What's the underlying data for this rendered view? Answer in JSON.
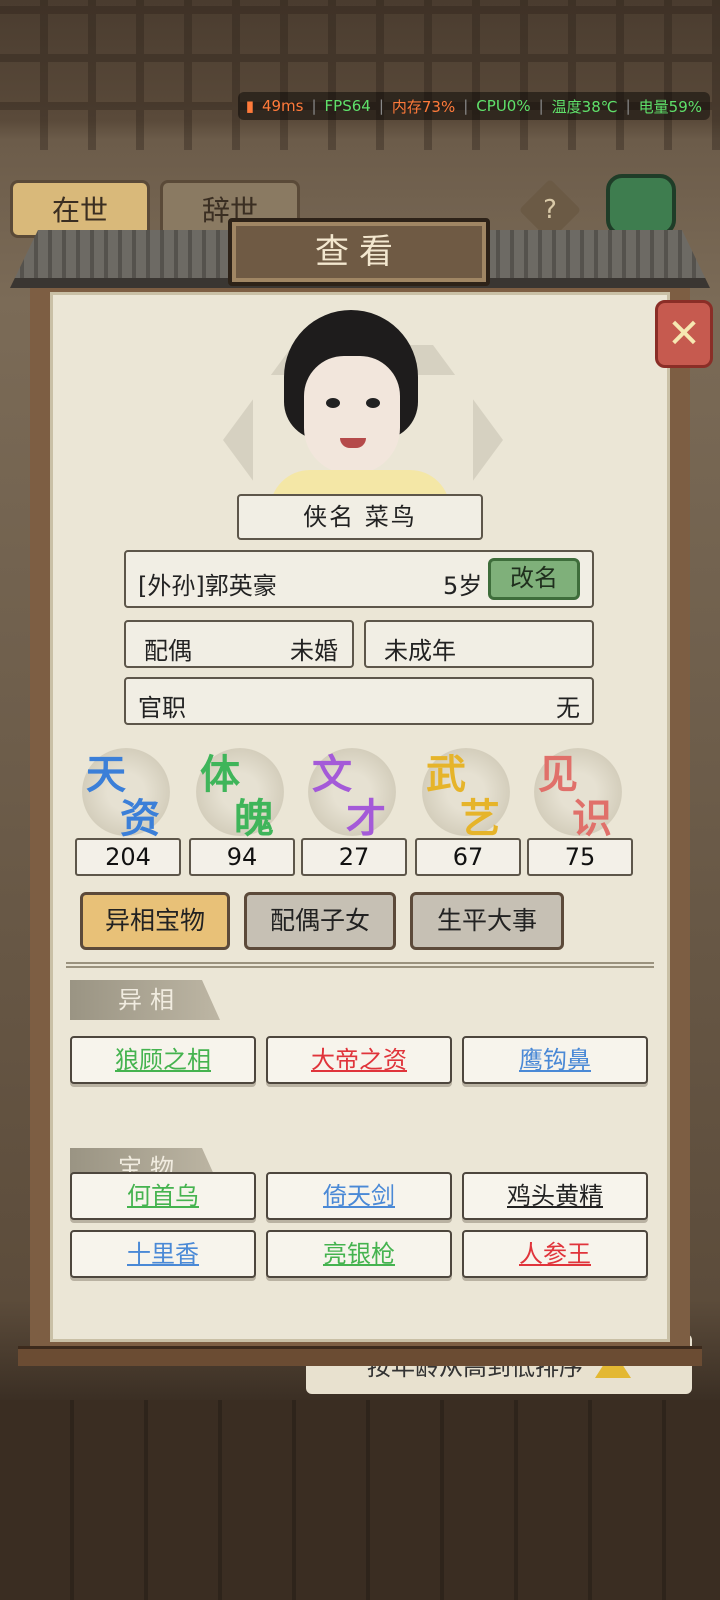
{
  "status_bar": {
    "ping": "49ms",
    "fps": "FPS64",
    "memory": "内存73%",
    "cpu": "CPU0%",
    "temperature": "温度38℃",
    "battery": "电量59%"
  },
  "background_tabs": [
    "在世",
    "辞世"
  ],
  "background_sort_label": "按年龄从高到低排序",
  "dialog": {
    "title": "查看",
    "name_label": "侠名 菜鸟",
    "character_name": "[外孙]郭英豪",
    "age": "5岁",
    "rename_button": "改名",
    "spouse_label": "配偶",
    "spouse_value": "未婚",
    "adult_status": "未成年",
    "office_label": "官职",
    "office_value": "无"
  },
  "stats": [
    {
      "name_a": "天",
      "name_b": "资",
      "value": "204",
      "color": "#3b7fd8"
    },
    {
      "name_a": "体",
      "name_b": "魄",
      "value": "94",
      "color": "#3fb55a"
    },
    {
      "name_a": "文",
      "name_b": "才",
      "value": "27",
      "color": "#a45ad8"
    },
    {
      "name_a": "武",
      "name_b": "艺",
      "value": "67",
      "color": "#e6b42a"
    },
    {
      "name_a": "见",
      "name_b": "识",
      "value": "75",
      "color": "#e0706a"
    }
  ],
  "tab_buttons": [
    "异相宝物",
    "配偶子女",
    "生平大事"
  ],
  "section_features": {
    "title": "异相",
    "items": [
      {
        "label": "狼顾之相",
        "color": "green"
      },
      {
        "label": "大帝之资",
        "color": "red"
      },
      {
        "label": "鹰钩鼻",
        "color": "blue"
      }
    ]
  },
  "section_treasures": {
    "title": "宝物",
    "items": [
      {
        "label": "何首乌",
        "color": "green"
      },
      {
        "label": "倚天剑",
        "color": "blue"
      },
      {
        "label": "鸡头黄精",
        "color": "black"
      },
      {
        "label": "十里香",
        "color": "blue"
      },
      {
        "label": "亮银枪",
        "color": "green"
      },
      {
        "label": "人参王",
        "color": "red"
      }
    ]
  }
}
